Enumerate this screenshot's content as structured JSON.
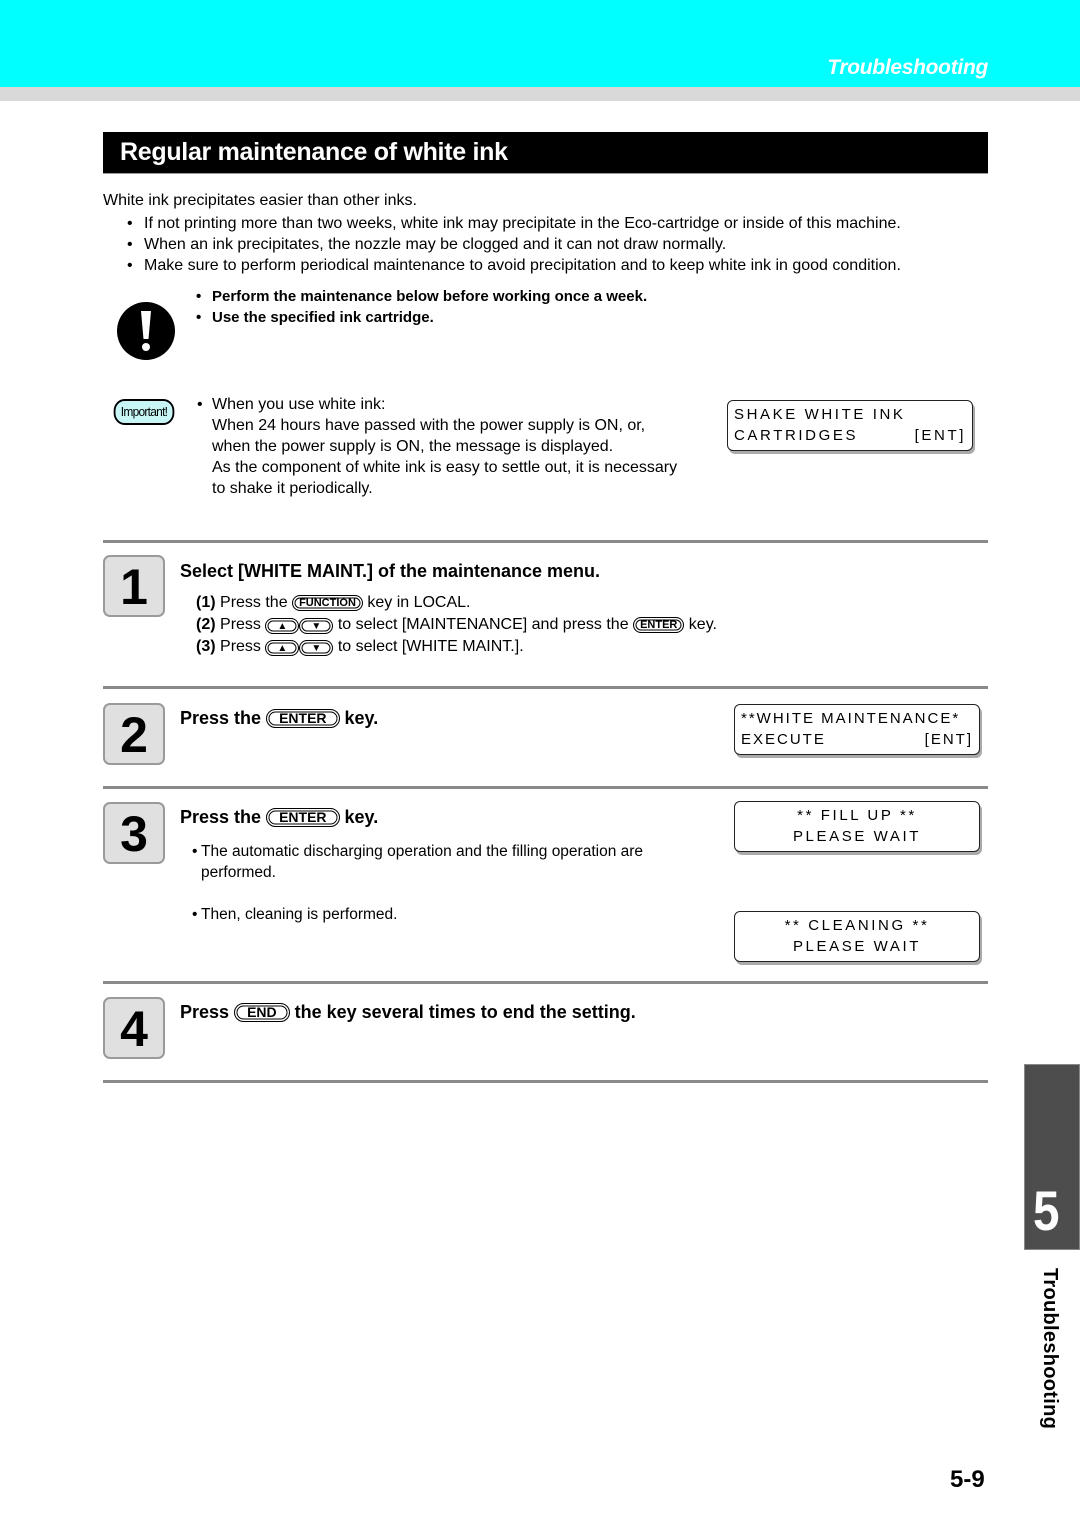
{
  "header": {
    "chapter_title": "Troubleshooting",
    "band_color": "#00ffff"
  },
  "section": {
    "title": "Regular maintenance of white ink"
  },
  "intro": {
    "lead": "White ink precipitates easier  than other inks.",
    "bullets": [
      "If not printing more than two weeks, white ink may precipitate in the Eco-cartridge or inside of this machine.",
      "When an ink precipitates, the nozzle may be clogged and it can not draw normally.",
      "Make sure to perform periodical maintenance to avoid precipitation and to keep white ink in good condition."
    ]
  },
  "caution": {
    "icon": "exclamation-circle-icon",
    "items": [
      "Perform the maintenance below before working once a week.",
      "Use the specified ink cartridge."
    ]
  },
  "important": {
    "badge": "Important!",
    "first_line": "When you use white ink:",
    "lines": [
      "When 24 hours have passed with the power supply is ON, or,",
      "when the power supply is ON, the message is displayed.",
      "As the component of white ink is easy to settle out, it is necessary",
      "to shake it periodically."
    ],
    "lcd": {
      "line1": "SHAKE WHITE INK",
      "line2_left": "CARTRIDGES",
      "line2_right": "[ENT]"
    }
  },
  "steps": [
    {
      "number": "1",
      "title": "Select [WHITE MAINT.] of the maintenance menu.",
      "substeps": [
        {
          "num": "(1)",
          "pre": "Press the",
          "key": "FUNCTION",
          "post": "key in LOCAL."
        },
        {
          "num": "(2)",
          "pre": "Press",
          "arrows": [
            "▲",
            "▼"
          ],
          "mid": "to select [MAINTENANCE] and press the",
          "key": "ENTER",
          "post": "key."
        },
        {
          "num": "(3)",
          "pre": "Press",
          "arrows": [
            "▲",
            "▼"
          ],
          "post": "to select [WHITE MAINT.]."
        }
      ]
    },
    {
      "number": "2",
      "title_pre": "Press the",
      "key": "ENTER",
      "title_post": "key.",
      "lcd": {
        "line1": "**WHITE MAINTENANCE*",
        "line2_left": "EXECUTE",
        "line2_right": "[ENT]"
      }
    },
    {
      "number": "3",
      "title_pre": "Press the",
      "key": "ENTER",
      "title_post": "key.",
      "bullets": [
        "The automatic discharging operation and the filling operation are performed.",
        "Then, cleaning is performed."
      ],
      "lcd_fill": {
        "line1": "** FILL UP **",
        "line2": "PLEASE WAIT"
      },
      "lcd_clean": {
        "line1": "** CLEANING **",
        "line2": "PLEASE WAIT"
      }
    },
    {
      "number": "4",
      "title_pre": "Press",
      "key": "END",
      "title_post": "the key several times to end the setting."
    }
  ],
  "side_tab": {
    "chapter_number": "5",
    "label": "Troubleshooting"
  },
  "page_number": "5-9"
}
